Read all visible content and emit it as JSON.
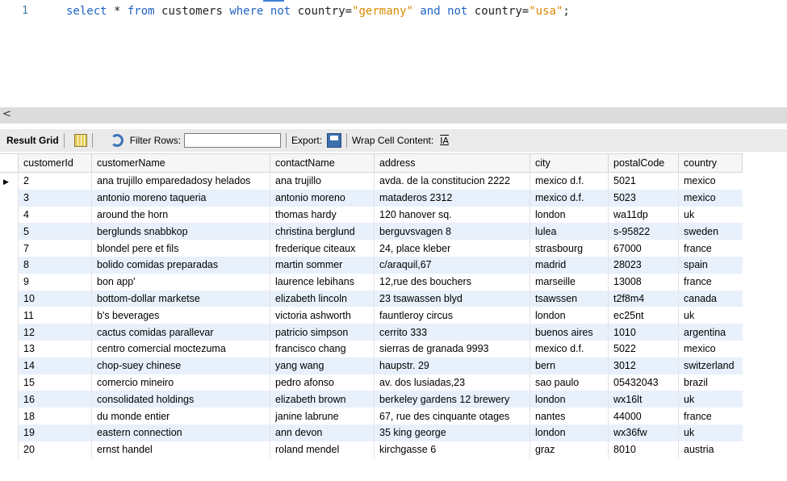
{
  "editor": {
    "line_number": "1",
    "sql": {
      "select": "select",
      "star": " * ",
      "from": "from",
      "table": " customers ",
      "where": "where",
      "not1": " not ",
      "col1": "country=",
      "val1": "\"germany\"",
      "and": " and ",
      "not2": "not ",
      "col2": "country=",
      "val2": "\"usa\"",
      "end": ";"
    }
  },
  "scrollbar": {
    "left_arrow": "<"
  },
  "toolbar": {
    "result_grid": "Result Grid",
    "filter_rows": "Filter Rows:",
    "filter_value": "",
    "export": "Export:",
    "wrap": "Wrap Cell Content:",
    "wrap_icon": "IA"
  },
  "grid": {
    "headers": [
      "customerId",
      "customerName",
      "contactName",
      "address",
      "city",
      "postalCode",
      "country"
    ],
    "rows": [
      [
        "2",
        "ana trujillo emparedadosy helados",
        "ana trujillo",
        "avda. de la constitucion 2222",
        "mexico d.f.",
        "5021",
        "mexico"
      ],
      [
        "3",
        "antonio moreno taqueria",
        "antonio moreno",
        "mataderos 2312",
        "mexico d.f.",
        "5023",
        "mexico"
      ],
      [
        "4",
        "around the horn",
        "thomas hardy",
        "120 hanover sq.",
        "london",
        "wa11dp",
        "uk"
      ],
      [
        "5",
        "berglunds snabbkop",
        "christina berglund",
        "berguvsvagen 8",
        "lulea",
        "s-95822",
        "sweden"
      ],
      [
        "7",
        "blondel pere et fils",
        "frederique citeaux",
        "24, place kleber",
        "strasbourg",
        "67000",
        "france"
      ],
      [
        "8",
        "bolido comidas preparadas",
        "martin sommer",
        "c/araquil,67",
        "madrid",
        "28023",
        "spain"
      ],
      [
        "9",
        "bon app'",
        "laurence lebihans",
        "12,rue des bouchers",
        "marseille",
        "13008",
        "france"
      ],
      [
        "10",
        "bottom-dollar marketse",
        "elizabeth lincoln",
        "23 tsawassen blyd",
        "tsawssen",
        "t2f8m4",
        "canada"
      ],
      [
        "11",
        "b's beverages",
        "victoria ashworth",
        "fauntleroy circus",
        "london",
        "ec25nt",
        "uk"
      ],
      [
        "12",
        "cactus comidas parallevar",
        "patricio simpson",
        "cerrito 333",
        "buenos aires",
        "1010",
        "argentina"
      ],
      [
        "13",
        "centro comercial moctezuma",
        "francisco chang",
        "sierras de granada 9993",
        "mexico d.f.",
        "5022",
        "mexico"
      ],
      [
        "14",
        "chop-suey chinese",
        "yang wang",
        "haupstr. 29",
        "bern",
        "3012",
        "switzerland"
      ],
      [
        "15",
        "comercio mineiro",
        "pedro afonso",
        "av. dos lusiadas,23",
        "sao paulo",
        "05432043",
        "brazil"
      ],
      [
        "16",
        "consolidated holdings",
        "elizabeth brown",
        "berkeley gardens 12 brewery",
        "london",
        "wx16lt",
        "uk"
      ],
      [
        "18",
        "du monde entier",
        "janine labrune",
        "67, rue des cinquante otages",
        "nantes",
        "44000",
        "france"
      ],
      [
        "19",
        "eastern connection",
        "ann devon",
        "35 king george",
        "london",
        "wx36fw",
        "uk"
      ],
      [
        "20",
        "ernst handel",
        "roland mendel",
        "kirchgasse 6",
        "graz",
        "8010",
        "austria"
      ]
    ]
  }
}
